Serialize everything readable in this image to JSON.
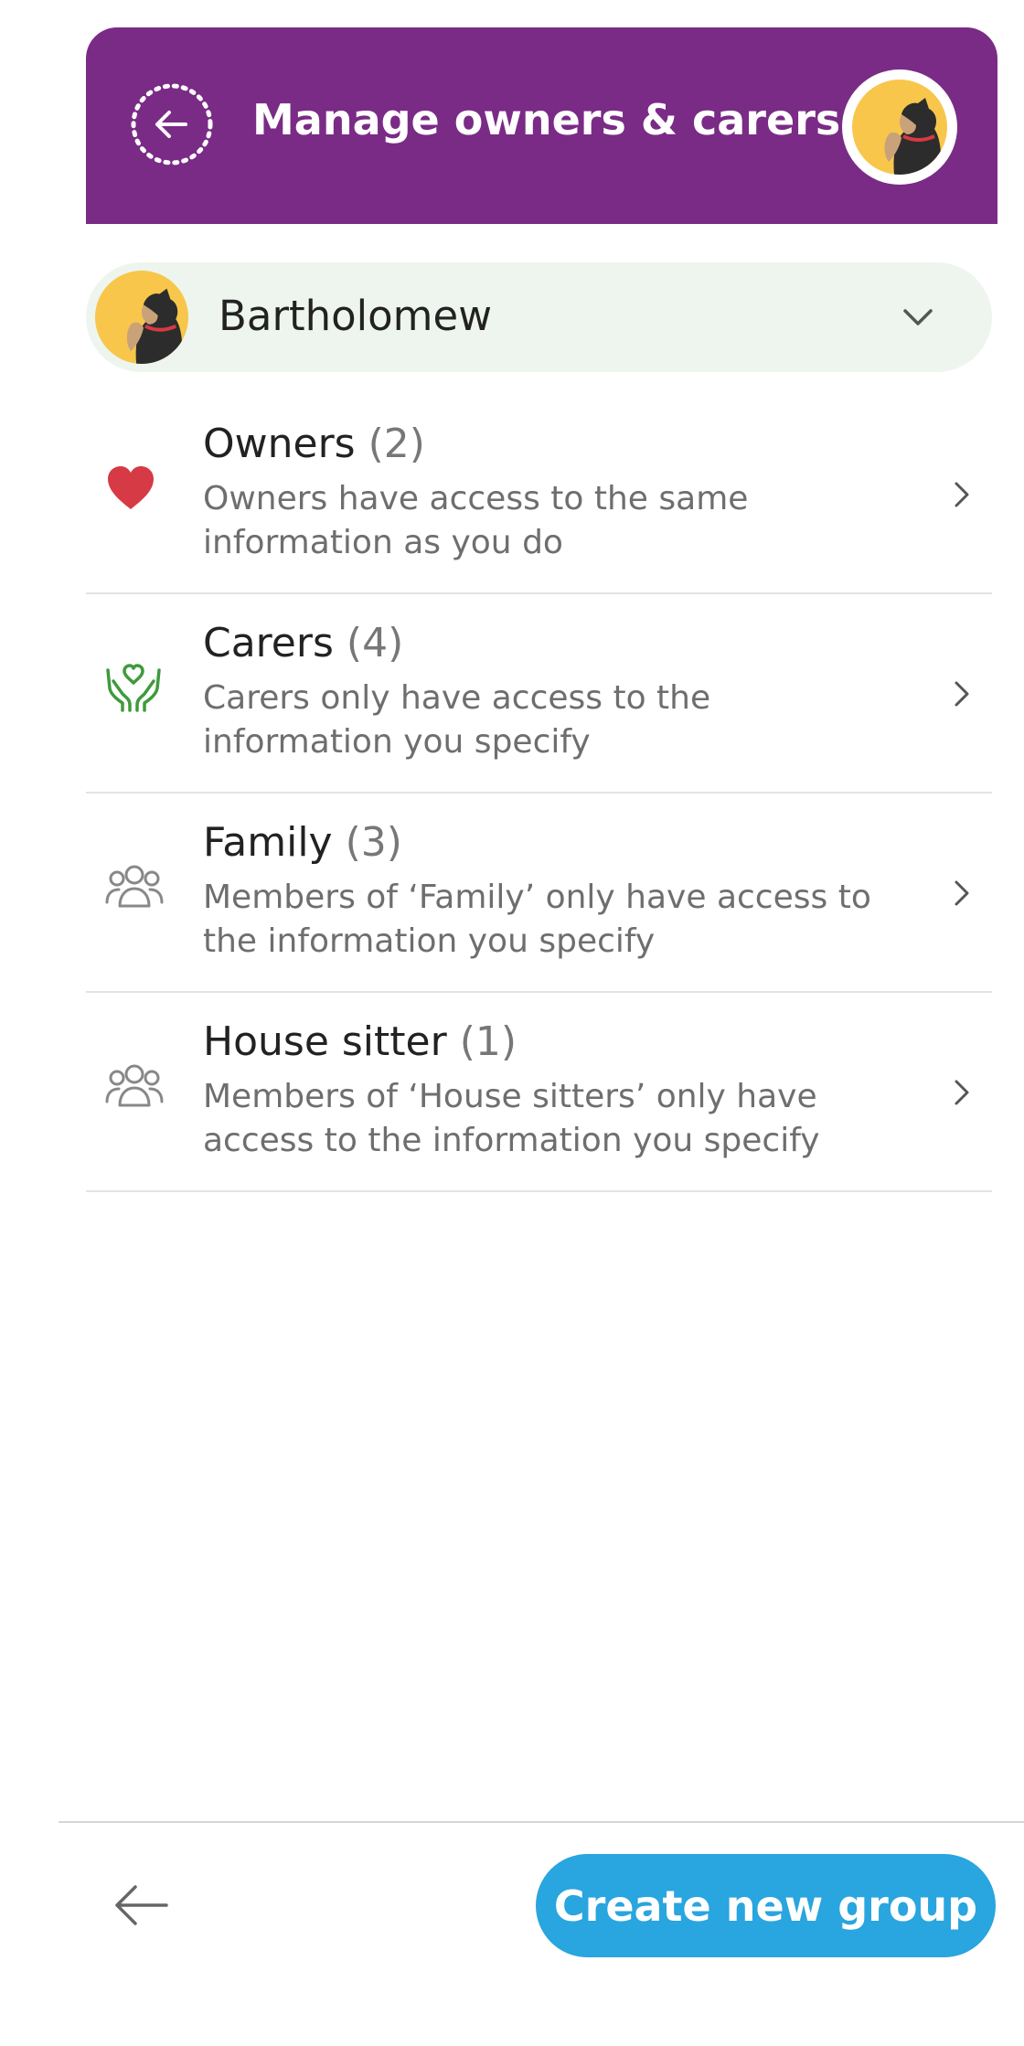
{
  "header": {
    "title": "Manage owners & carers",
    "background_color": "#7a2b86",
    "back_icon": "arrow-left-icon",
    "avatar_icon": "dog-avatar-icon"
  },
  "pet_selector": {
    "name": "Bartholomew",
    "avatar_icon": "dog-avatar-icon",
    "dropdown_icon": "chevron-down-icon"
  },
  "groups": [
    {
      "title": "Owners",
      "count": "(2)",
      "description": "Owners have access to the same information as you do",
      "icon": "heart-icon",
      "icon_color": "#d63a44"
    },
    {
      "title": "Carers",
      "count": "(4)",
      "description": "Carers only have access to the information you specify",
      "icon": "caring-hands-heart-icon",
      "icon_color": "#3f9a3c"
    },
    {
      "title": "Family",
      "count": "(3)",
      "description": "Members of ‘Family’ only have access to the information you specify",
      "icon": "people-group-icon",
      "icon_color": "#888888"
    },
    {
      "title": "House sitter",
      "count": "(1)",
      "description": "Members of ‘House sitters’ only have access to the information you specify",
      "icon": "people-group-icon",
      "icon_color": "#888888"
    }
  ],
  "footer": {
    "back_icon": "arrow-left-icon",
    "create_button_label": "Create new group",
    "create_button_color": "#29a5df"
  }
}
